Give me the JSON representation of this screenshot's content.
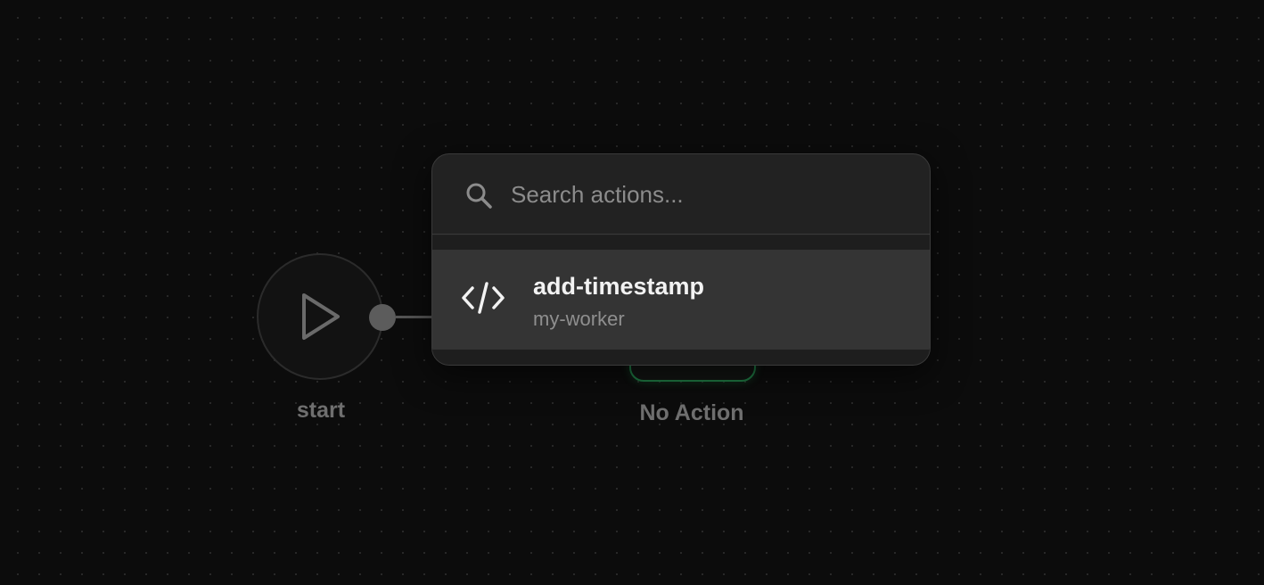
{
  "canvas": {
    "nodes": {
      "start": {
        "label": "start",
        "icon": "play-icon"
      },
      "no_action": {
        "label": "No Action",
        "accent": "#1f7a44"
      }
    }
  },
  "action_picker": {
    "search": {
      "placeholder": "Search actions...",
      "value": "",
      "icon": "search-icon"
    },
    "results": [
      {
        "title": "add-timestamp",
        "subtitle": "my-worker",
        "icon": "code-icon"
      }
    ]
  }
}
